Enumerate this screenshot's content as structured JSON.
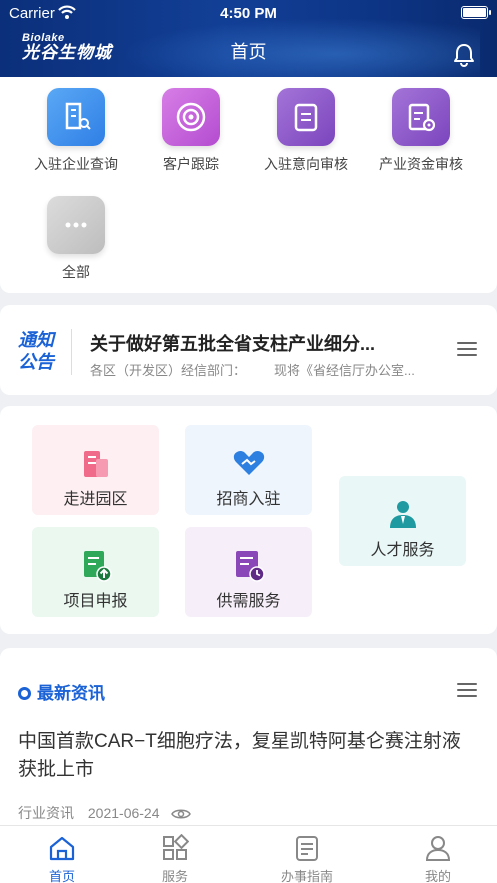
{
  "status_bar": {
    "carrier": "Carrier",
    "time": "4:50 PM"
  },
  "header": {
    "logo_en": "Biolake",
    "logo_cn": "光谷生物城",
    "title": "首页"
  },
  "quick_menu": [
    {
      "label": "入驻企业查询",
      "icon": "building-search-icon",
      "color": "#3d8ff0"
    },
    {
      "label": "客户跟踪",
      "icon": "target-icon",
      "color": "#c45fd6"
    },
    {
      "label": "入驻意向审核",
      "icon": "document-icon",
      "color": "#8e55c7"
    },
    {
      "label": "产业资金审核",
      "icon": "file-gear-icon",
      "color": "#8e55c7"
    },
    {
      "label": "全部",
      "icon": "more-icon",
      "color": "#c9c9c9"
    }
  ],
  "notice": {
    "badge_line1": "通知",
    "badge_line2": "公告",
    "title": "关于做好第五批全省支柱产业细分...",
    "sub1": "各区（开发区）经信部门：",
    "sub2": "现将《省经信厅办公室..."
  },
  "services": [
    {
      "label": "走进园区",
      "icon": "park-building-icon",
      "bg": "#fdeff2"
    },
    {
      "label": "招商入驻",
      "icon": "handshake-icon",
      "bg": "#eef5fc"
    },
    {
      "label": "人才服务",
      "icon": "person-icon",
      "bg": "#eaf7f7"
    },
    {
      "label": "项目申报",
      "icon": "report-upload-icon",
      "bg": "#eaf8ef"
    },
    {
      "label": "供需服务",
      "icon": "doc-clock-icon",
      "bg": "#f6eef9"
    }
  ],
  "news": {
    "section_title": "最新资讯",
    "title": "中国首款CAR−T细胞疗法，复星凯特阿基仑赛注射液获批上市",
    "category": "行业资讯",
    "date": "2021-06-24"
  },
  "tabs": [
    {
      "label": "首页",
      "icon": "home-icon"
    },
    {
      "label": "服务",
      "icon": "grid-icon"
    },
    {
      "label": "办事指南",
      "icon": "guide-icon"
    },
    {
      "label": "我的",
      "icon": "user-icon"
    }
  ]
}
